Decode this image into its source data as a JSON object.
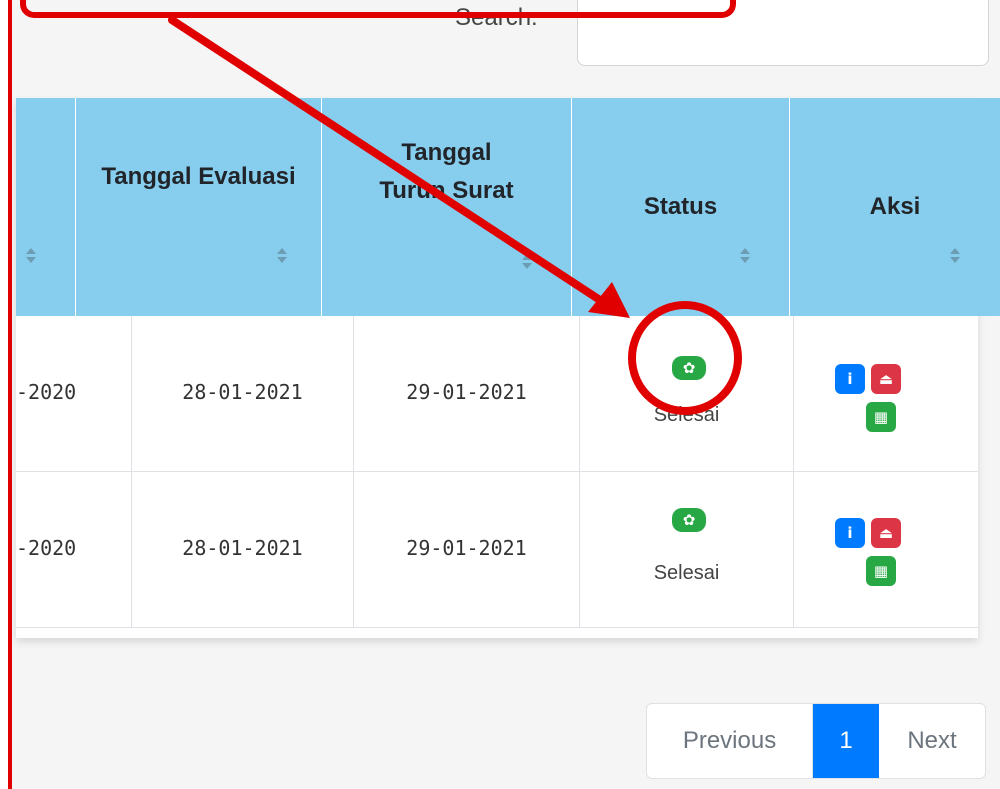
{
  "search": {
    "label": "Search:",
    "value": ""
  },
  "table": {
    "headers": [
      {
        "label": ""
      },
      {
        "label": "Tanggal Evaluasi"
      },
      {
        "label": "Tanggal Turun Surat"
      },
      {
        "label": "Status"
      },
      {
        "label": "Aksi"
      }
    ],
    "rows": [
      {
        "date_start": "-2020",
        "tanggal_evaluasi": "28-01-2021",
        "tanggal_turun_surat": "29-01-2021",
        "status": "Selesai"
      },
      {
        "date_start": "-2020",
        "tanggal_evaluasi": "28-01-2021",
        "tanggal_turun_surat": "29-01-2021",
        "status": "Selesai"
      }
    ],
    "action_icons": {
      "info": "i",
      "upload": "⏏",
      "calendar": "▦"
    }
  },
  "pagination": {
    "previous": "Previous",
    "current": "1",
    "next": "Next"
  },
  "colors": {
    "header_bg": "#87cdee",
    "status_green": "#28a745",
    "info_blue": "#007bff",
    "upload_red": "#dc3545",
    "annotation_red": "#e00000",
    "page_active": "#007bff"
  },
  "icons": {
    "sort": "sort-both-icon",
    "status": "gear-icon",
    "info": "info-icon",
    "upload": "upload-icon",
    "calendar": "calendar-icon"
  }
}
